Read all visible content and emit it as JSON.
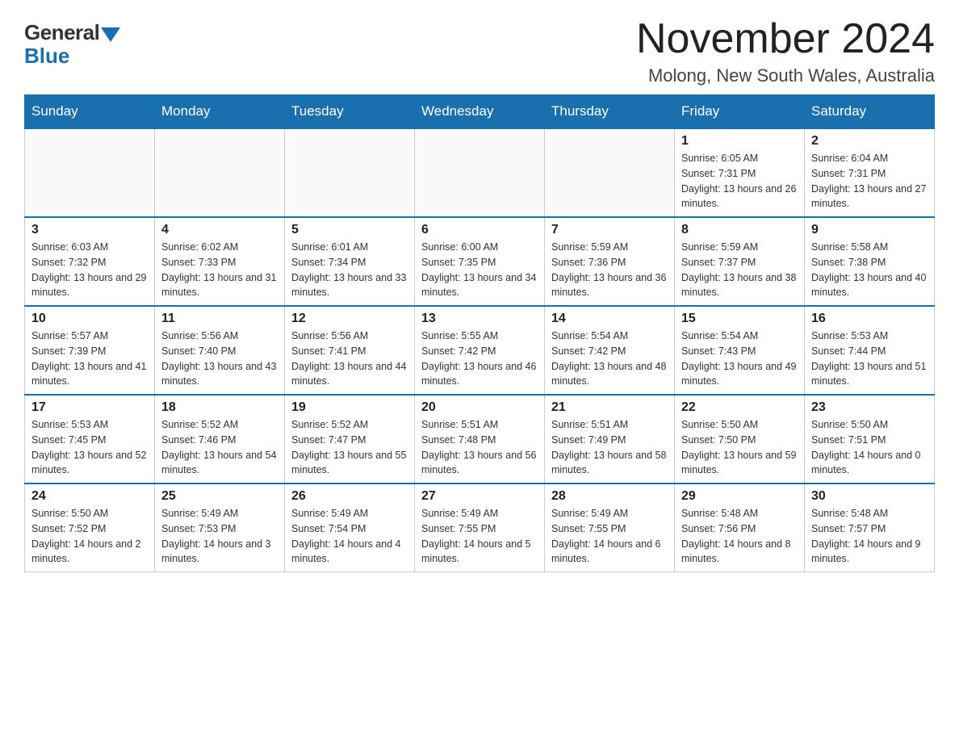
{
  "header": {
    "logo_general": "General",
    "logo_blue": "Blue",
    "month_title": "November 2024",
    "location": "Molong, New South Wales, Australia"
  },
  "weekdays": [
    "Sunday",
    "Monday",
    "Tuesday",
    "Wednesday",
    "Thursday",
    "Friday",
    "Saturday"
  ],
  "weeks": [
    [
      {
        "day": "",
        "info": ""
      },
      {
        "day": "",
        "info": ""
      },
      {
        "day": "",
        "info": ""
      },
      {
        "day": "",
        "info": ""
      },
      {
        "day": "",
        "info": ""
      },
      {
        "day": "1",
        "info": "Sunrise: 6:05 AM\nSunset: 7:31 PM\nDaylight: 13 hours and 26 minutes."
      },
      {
        "day": "2",
        "info": "Sunrise: 6:04 AM\nSunset: 7:31 PM\nDaylight: 13 hours and 27 minutes."
      }
    ],
    [
      {
        "day": "3",
        "info": "Sunrise: 6:03 AM\nSunset: 7:32 PM\nDaylight: 13 hours and 29 minutes."
      },
      {
        "day": "4",
        "info": "Sunrise: 6:02 AM\nSunset: 7:33 PM\nDaylight: 13 hours and 31 minutes."
      },
      {
        "day": "5",
        "info": "Sunrise: 6:01 AM\nSunset: 7:34 PM\nDaylight: 13 hours and 33 minutes."
      },
      {
        "day": "6",
        "info": "Sunrise: 6:00 AM\nSunset: 7:35 PM\nDaylight: 13 hours and 34 minutes."
      },
      {
        "day": "7",
        "info": "Sunrise: 5:59 AM\nSunset: 7:36 PM\nDaylight: 13 hours and 36 minutes."
      },
      {
        "day": "8",
        "info": "Sunrise: 5:59 AM\nSunset: 7:37 PM\nDaylight: 13 hours and 38 minutes."
      },
      {
        "day": "9",
        "info": "Sunrise: 5:58 AM\nSunset: 7:38 PM\nDaylight: 13 hours and 40 minutes."
      }
    ],
    [
      {
        "day": "10",
        "info": "Sunrise: 5:57 AM\nSunset: 7:39 PM\nDaylight: 13 hours and 41 minutes."
      },
      {
        "day": "11",
        "info": "Sunrise: 5:56 AM\nSunset: 7:40 PM\nDaylight: 13 hours and 43 minutes."
      },
      {
        "day": "12",
        "info": "Sunrise: 5:56 AM\nSunset: 7:41 PM\nDaylight: 13 hours and 44 minutes."
      },
      {
        "day": "13",
        "info": "Sunrise: 5:55 AM\nSunset: 7:42 PM\nDaylight: 13 hours and 46 minutes."
      },
      {
        "day": "14",
        "info": "Sunrise: 5:54 AM\nSunset: 7:42 PM\nDaylight: 13 hours and 48 minutes."
      },
      {
        "day": "15",
        "info": "Sunrise: 5:54 AM\nSunset: 7:43 PM\nDaylight: 13 hours and 49 minutes."
      },
      {
        "day": "16",
        "info": "Sunrise: 5:53 AM\nSunset: 7:44 PM\nDaylight: 13 hours and 51 minutes."
      }
    ],
    [
      {
        "day": "17",
        "info": "Sunrise: 5:53 AM\nSunset: 7:45 PM\nDaylight: 13 hours and 52 minutes."
      },
      {
        "day": "18",
        "info": "Sunrise: 5:52 AM\nSunset: 7:46 PM\nDaylight: 13 hours and 54 minutes."
      },
      {
        "day": "19",
        "info": "Sunrise: 5:52 AM\nSunset: 7:47 PM\nDaylight: 13 hours and 55 minutes."
      },
      {
        "day": "20",
        "info": "Sunrise: 5:51 AM\nSunset: 7:48 PM\nDaylight: 13 hours and 56 minutes."
      },
      {
        "day": "21",
        "info": "Sunrise: 5:51 AM\nSunset: 7:49 PM\nDaylight: 13 hours and 58 minutes."
      },
      {
        "day": "22",
        "info": "Sunrise: 5:50 AM\nSunset: 7:50 PM\nDaylight: 13 hours and 59 minutes."
      },
      {
        "day": "23",
        "info": "Sunrise: 5:50 AM\nSunset: 7:51 PM\nDaylight: 14 hours and 0 minutes."
      }
    ],
    [
      {
        "day": "24",
        "info": "Sunrise: 5:50 AM\nSunset: 7:52 PM\nDaylight: 14 hours and 2 minutes."
      },
      {
        "day": "25",
        "info": "Sunrise: 5:49 AM\nSunset: 7:53 PM\nDaylight: 14 hours and 3 minutes."
      },
      {
        "day": "26",
        "info": "Sunrise: 5:49 AM\nSunset: 7:54 PM\nDaylight: 14 hours and 4 minutes."
      },
      {
        "day": "27",
        "info": "Sunrise: 5:49 AM\nSunset: 7:55 PM\nDaylight: 14 hours and 5 minutes."
      },
      {
        "day": "28",
        "info": "Sunrise: 5:49 AM\nSunset: 7:55 PM\nDaylight: 14 hours and 6 minutes."
      },
      {
        "day": "29",
        "info": "Sunrise: 5:48 AM\nSunset: 7:56 PM\nDaylight: 14 hours and 8 minutes."
      },
      {
        "day": "30",
        "info": "Sunrise: 5:48 AM\nSunset: 7:57 PM\nDaylight: 14 hours and 9 minutes."
      }
    ]
  ]
}
